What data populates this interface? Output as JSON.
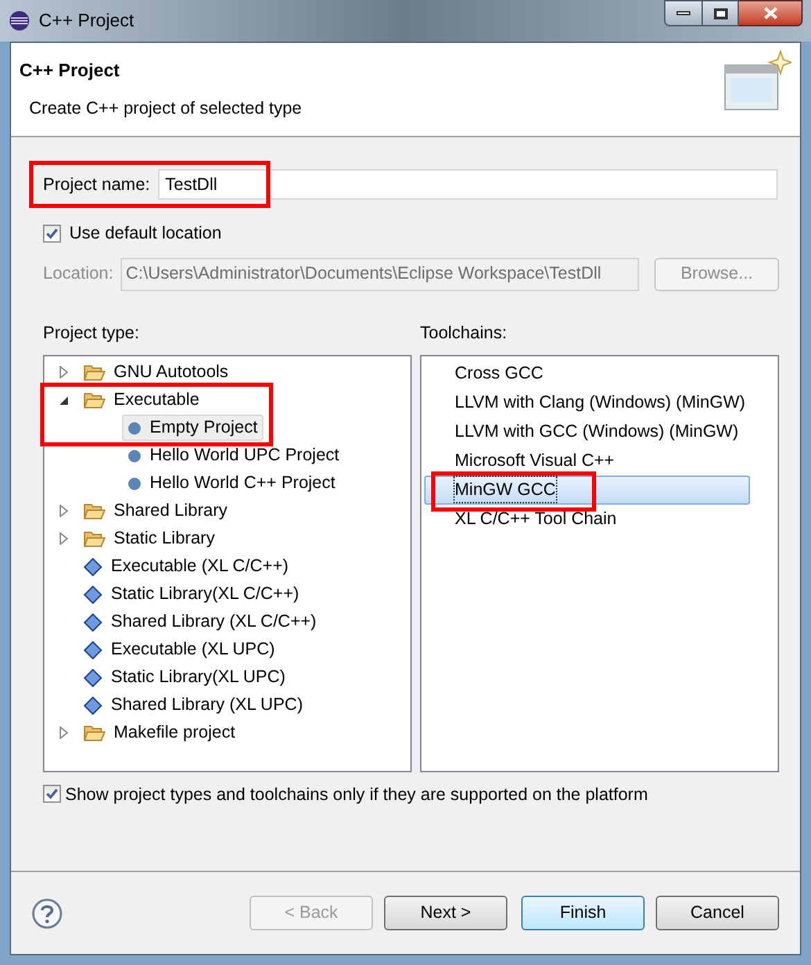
{
  "window": {
    "title": "C++ Project"
  },
  "header": {
    "title": "C++ Project",
    "description": "Create C++ project of selected type"
  },
  "project_name": {
    "label": "Project name:",
    "value": "TestDll",
    "highlighted": true
  },
  "use_default_location": {
    "label": "Use default location",
    "checked": true
  },
  "location": {
    "label": "Location:",
    "value": "C:\\Users\\Administrator\\Documents\\Eclipse Workspace\\TestDll",
    "disabled": true,
    "browse": "Browse..."
  },
  "project_type": {
    "label": "Project type:",
    "items": [
      {
        "kind": "folder",
        "label": "GNU Autotools",
        "expanded": false,
        "selected": false
      },
      {
        "kind": "folder",
        "label": "Executable",
        "expanded": true,
        "selected": false,
        "highlighted": true,
        "children": [
          {
            "kind": "leaf",
            "label": "Empty Project",
            "selected": true
          },
          {
            "kind": "leaf",
            "label": "Hello World UPC Project",
            "selected": false
          },
          {
            "kind": "leaf",
            "label": "Hello World C++ Project",
            "selected": false
          }
        ]
      },
      {
        "kind": "folder",
        "label": "Shared Library",
        "expanded": false,
        "selected": false
      },
      {
        "kind": "folder",
        "label": "Static Library",
        "expanded": false,
        "selected": false
      },
      {
        "kind": "item",
        "label": "Executable (XL C/C++)",
        "selected": false
      },
      {
        "kind": "item",
        "label": "Static Library(XL C/C++)",
        "selected": false
      },
      {
        "kind": "item",
        "label": "Shared Library (XL C/C++)",
        "selected": false
      },
      {
        "kind": "item",
        "label": "Executable (XL UPC)",
        "selected": false
      },
      {
        "kind": "item",
        "label": "Static Library(XL UPC)",
        "selected": false
      },
      {
        "kind": "item",
        "label": "Shared Library (XL UPC)",
        "selected": false
      },
      {
        "kind": "folder",
        "label": "Makefile project",
        "expanded": false,
        "selected": false
      }
    ]
  },
  "toolchains": {
    "label": "Toolchains:",
    "items": [
      {
        "label": "Cross GCC",
        "selected": false,
        "highlighted": false
      },
      {
        "label": "LLVM with Clang (Windows) (MinGW)",
        "selected": false,
        "highlighted": false
      },
      {
        "label": "LLVM with GCC (Windows) (MinGW)",
        "selected": false,
        "highlighted": false
      },
      {
        "label": "Microsoft Visual C++",
        "selected": false,
        "highlighted": false
      },
      {
        "label": "MinGW GCC",
        "selected": true,
        "highlighted": true
      },
      {
        "label": "XL C/C++ Tool Chain",
        "selected": false,
        "highlighted": false
      }
    ]
  },
  "show_supported": {
    "label": "Show project types and toolchains only if they are supported on the platform",
    "checked": true
  },
  "buttons": [
    {
      "label": "< Back",
      "disabled": true,
      "default": false
    },
    {
      "label": "Next >",
      "disabled": false,
      "default": false
    },
    {
      "label": "Finish",
      "disabled": false,
      "default": true
    },
    {
      "label": "Cancel",
      "disabled": false,
      "default": false
    }
  ]
}
